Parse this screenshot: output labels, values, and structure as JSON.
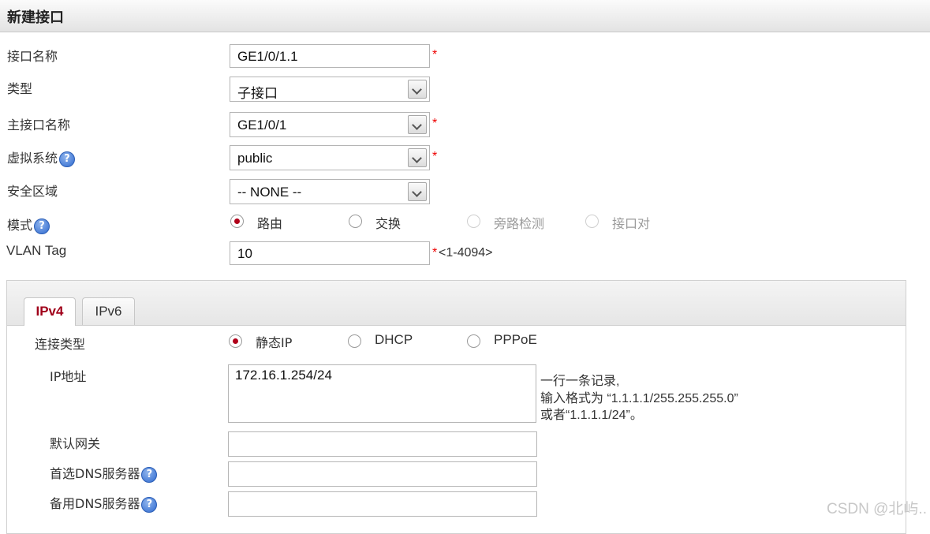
{
  "title": "新建接口",
  "fields": {
    "if_name": {
      "label": "接口名称",
      "value": "GE1/0/1.1",
      "required_mark": "*"
    },
    "type": {
      "label": "类型",
      "value": "子接口"
    },
    "parent_if": {
      "label": "主接口名称",
      "value": "GE1/0/1",
      "required_mark": "*"
    },
    "vsys": {
      "label": "虚拟系统",
      "value": "public",
      "required_mark": "*"
    },
    "zone": {
      "label": "安全区域",
      "value": "-- NONE --"
    },
    "mode": {
      "label": "模式",
      "options": [
        {
          "label": "路由",
          "selected": true,
          "disabled": false
        },
        {
          "label": "交换",
          "selected": false,
          "disabled": false
        },
        {
          "label": "旁路检测",
          "selected": false,
          "disabled": true
        },
        {
          "label": "接口对",
          "selected": false,
          "disabled": true
        }
      ]
    },
    "vlan": {
      "label": "VLAN Tag",
      "value": "10",
      "required_mark": "*",
      "range": "<1-4094>"
    }
  },
  "help_icon": "?",
  "tabs": [
    {
      "label": "IPv4",
      "active": true
    },
    {
      "label": "IPv6",
      "active": false
    }
  ],
  "ipv4": {
    "conn_type": {
      "label": "连接类型",
      "options": [
        {
          "label": "静态IP",
          "selected": true
        },
        {
          "label": "DHCP",
          "selected": false
        },
        {
          "label": "PPPoE",
          "selected": false
        }
      ]
    },
    "ip": {
      "label": "IP地址",
      "value": "172.16.1.254/24",
      "hint_line1": "一行一条记录,",
      "hint_line2": "输入格式为 “1.1.1.1/255.255.255.0”",
      "hint_line3": "或者“1.1.1.1/24”。"
    },
    "gateway": {
      "label": "默认网关",
      "value": ""
    },
    "dns1": {
      "label": "首选DNS服务器",
      "value": ""
    },
    "dns2": {
      "label": "备用DNS服务器",
      "value": ""
    }
  },
  "watermark": "CSDN @北屿..",
  "colors": {
    "accent": "#a0001a",
    "required": "#e00000",
    "help": "#2f6ad0"
  }
}
